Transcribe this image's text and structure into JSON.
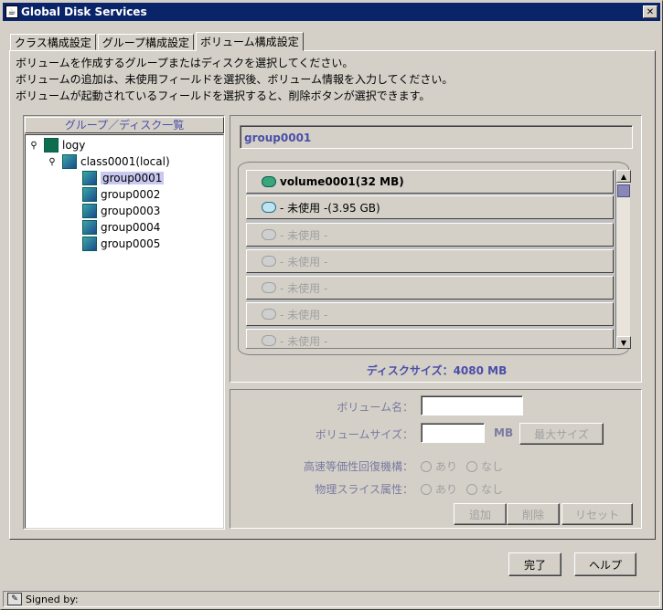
{
  "window": {
    "title": "Global Disk Services"
  },
  "tabs": [
    {
      "label": "クラス構成設定"
    },
    {
      "label": "グループ構成設定"
    },
    {
      "label": "ボリューム構成設定"
    }
  ],
  "instructions": [
    "ボリュームを作成するグループまたはディスクを選択してください。",
    "ボリュームの追加は、未使用フィールドを選択後、ボリューム情報を入力してください。",
    "ボリュームが起動されているフィールドを選択すると、削除ボタンが選択できます。"
  ],
  "tree": {
    "header": "グループ／ディスク一覧",
    "root": "logy",
    "class": "class0001(local)",
    "groups": [
      "group0001",
      "group0002",
      "group0003",
      "group0004",
      "group0005"
    ]
  },
  "disk": {
    "selected_group": "group0001",
    "volumes": [
      {
        "label": "volume0001(32 MB)"
      },
      {
        "label": "- 未使用 -(3.95 GB)"
      },
      {
        "label": "- 未使用 -"
      },
      {
        "label": "- 未使用 -"
      },
      {
        "label": "- 未使用 -"
      },
      {
        "label": "- 未使用 -"
      },
      {
        "label": "- 未使用 -"
      }
    ],
    "size_label": "ディスクサイズ：4080 MB"
  },
  "form": {
    "volume_name_label": "ボリューム名：",
    "volume_name_value": "",
    "volume_size_label": "ボリュームサイズ：",
    "volume_size_value": "",
    "unit": "MB",
    "max_size_button": "最大サイズ",
    "jrm_label": "高速等価性回復機構：",
    "physical_slice_label": "物理スライス属性：",
    "on": "あり",
    "off": "なし",
    "add_button": "追加",
    "delete_button": "削除",
    "reset_button": "リセット"
  },
  "footer": {
    "ok_button": "完了",
    "help_button": "ヘルプ"
  },
  "status": {
    "text": "Signed by:"
  }
}
